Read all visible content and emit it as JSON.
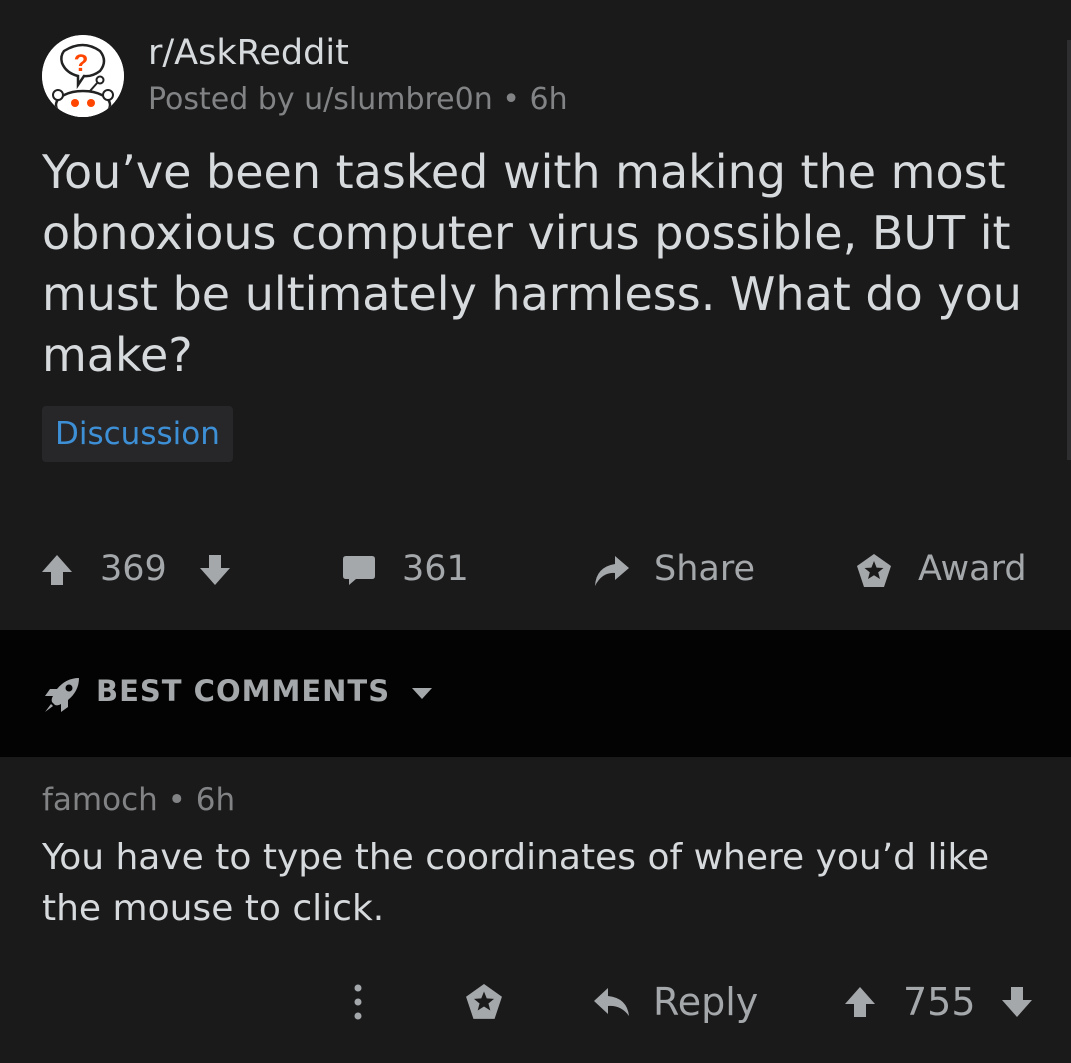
{
  "post": {
    "subreddit": "r/AskReddit",
    "posted_by": "Posted by u/slumbre0n • 6h",
    "title": "You’ve been tasked with making the most obnoxious computer virus possible, BUT it must be ultimately harmless. What do you make?",
    "flair": "Discussion",
    "score": "369",
    "comments_count": "361",
    "share_label": "Share",
    "award_label": "Award"
  },
  "sort": {
    "label": "BEST COMMENTS"
  },
  "comment": {
    "meta": "famoch • 6h",
    "body": "You have to type the coordinates of where you’d like the mouse to click.",
    "reply_label": "Reply",
    "score": "755"
  },
  "colors": {
    "background": "#1a1a1b",
    "sort_bar": "#030303",
    "flair_text": "#3d8fd6",
    "text_primary": "#d7dadc",
    "text_muted": "#818384",
    "avatar_orange": "#ff4500"
  }
}
